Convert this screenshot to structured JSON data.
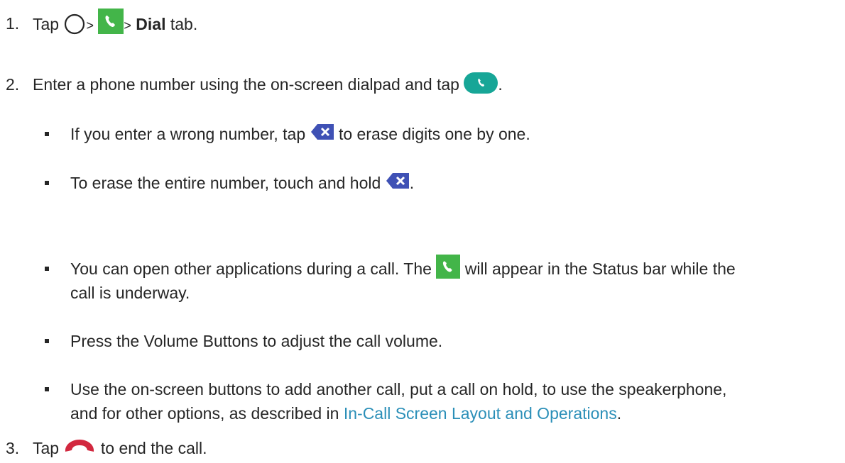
{
  "step1": {
    "num": "1.",
    "tap": "Tap",
    "sep1": ">",
    "sep2": ">",
    "dial": "Dial",
    "tab": "tab."
  },
  "step2": {
    "num": "2.",
    "text": "Enter a phone number using the on-screen dialpad and tap",
    "end": "."
  },
  "bullet_wrong": {
    "before": "If you enter a wrong number, tap",
    "after": "to erase digits one by one."
  },
  "bullet_erase": {
    "before": "To erase the entire number, touch and hold",
    "after": "."
  },
  "bullet_apps": {
    "before": "You can open other applications during a call. The",
    "after": "will appear in the Status bar while the",
    "line2": "call is underway."
  },
  "bullet_volume": {
    "text": "Press the Volume Buttons to adjust the call volume."
  },
  "bullet_buttons": {
    "line1": "Use the on-screen buttons to add another call, put a call on hold, to use the speakerphone,",
    "line2_before": "and for other options, as described in",
    "link": "In-Call Screen Layout and Operations",
    "line2_after": "."
  },
  "step3": {
    "num": "3.",
    "tap": "Tap",
    "after": "to end the call."
  },
  "colors": {
    "phone_green": "#43b549",
    "call_teal": "#17a697",
    "end_red": "#d2283f",
    "backspace_blue": "#3f51b5",
    "link": "#2b8fb8"
  },
  "icons": [
    "home-circle-icon",
    "phone-app-icon",
    "call-button-icon",
    "backspace-icon",
    "phone-status-icon",
    "end-call-icon"
  ]
}
